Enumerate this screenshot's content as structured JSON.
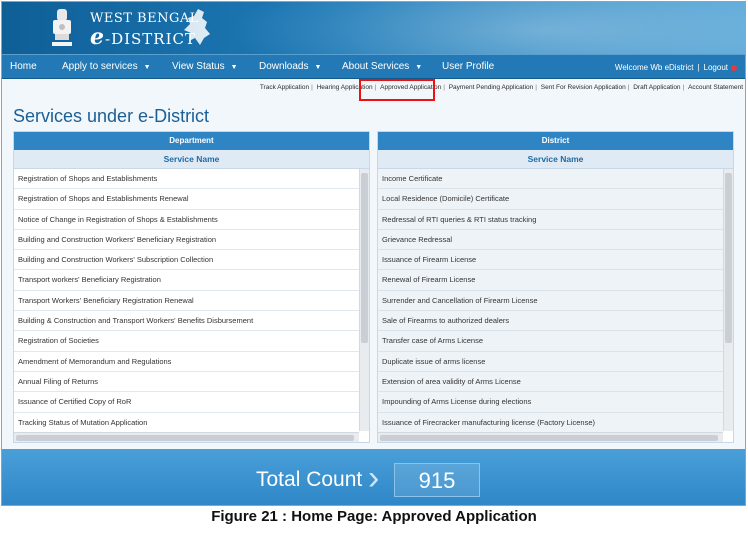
{
  "brand": {
    "line1": "WEST BENGAL",
    "line2_initial": "e",
    "line2_rest": "-DISTRICT"
  },
  "nav": {
    "items": [
      {
        "label": "Home",
        "has_caret": false
      },
      {
        "label": "Apply to services",
        "has_caret": true
      },
      {
        "label": "View Status",
        "has_caret": true
      },
      {
        "label": "Downloads",
        "has_caret": true
      },
      {
        "label": "About Services",
        "has_caret": true
      },
      {
        "label": "User Profile",
        "has_caret": false
      }
    ],
    "welcome": "Welcome Wb eDistrict",
    "logout": "Logout"
  },
  "sublinks": [
    "Track Application",
    "Hearing Application",
    "Approved Application",
    "Payment Pending Application",
    "Sent For Revision Application",
    "Draft Application",
    "Account Statement"
  ],
  "page_title": "Services under e-District",
  "department_panel": {
    "header": "Department",
    "subheader": "Service Name",
    "rows": [
      "Registration of Shops and Establishments",
      "Registration of Shops and Establishments Renewal",
      "Notice of Change in Registration of Shops & Establishments",
      "Building and Construction Workers' Beneficiary Registration",
      "Building and Construction Workers' Subscription Collection",
      "Transport workers' Beneficiary Registration",
      "Transport Workers' Beneficiary Registration Renewal",
      "Building & Construction and Transport Workers' Benefits Disbursement",
      "Registration of Societies",
      "Amendment of Memorandum and Regulations",
      "Annual Filing of Returns",
      "Issuance of Certified Copy of RoR",
      "Tracking Status of Mutation Application"
    ]
  },
  "district_panel": {
    "header": "District",
    "subheader": "Service Name",
    "rows": [
      "Income Certificate",
      "Local Residence (Domicile) Certificate",
      "Redressal of RTI queries & RTI status tracking",
      "Grievance Redressal",
      "Issuance of Firearm License",
      "Renewal of Firearm License",
      "Surrender and Cancellation of Firearm License",
      "Sale of Firearms to authorized dealers",
      "Transfer case of Arms License",
      "Duplicate issue of arms license",
      "Extension of area validity of Arms License",
      "Impounding of Arms License during elections",
      "Issuance of Firecracker manufacturing license (Factory License)"
    ]
  },
  "total": {
    "label": "Total Count",
    "value": "915"
  },
  "caption": "Figure 21 : Home Page: Approved Application",
  "colors": {
    "header_blue": "#1f7bb8",
    "nav_blue": "#2379b5",
    "highlight_red": "#ee1111",
    "title_blue": "#1a5f95"
  }
}
